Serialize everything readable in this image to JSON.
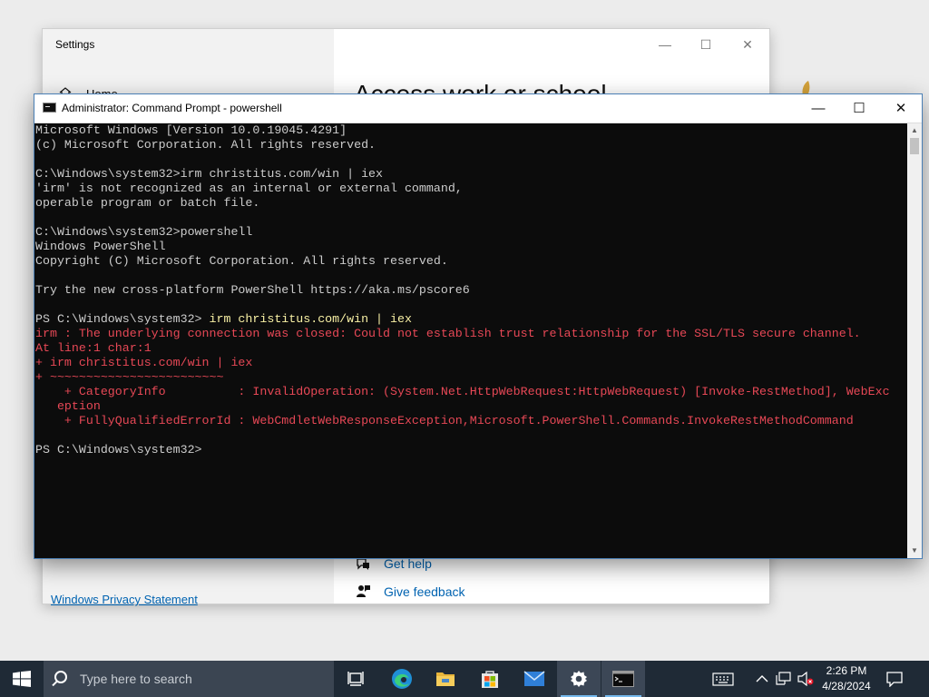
{
  "settings_window": {
    "title": "Settings",
    "home_label": "Home",
    "heading": "Access work or school",
    "get_help": "Get help",
    "give_feedback": "Give feedback",
    "privacy_link": "Windows Privacy Statement"
  },
  "cmd_window": {
    "title": "Administrator: Command Prompt - powershell",
    "lines": [
      {
        "text": "Microsoft Windows [Version 10.0.19045.4291]",
        "style": "normal"
      },
      {
        "text": "(c) Microsoft Corporation. All rights reserved.",
        "style": "normal"
      },
      {
        "text": "",
        "style": "normal"
      },
      {
        "text": "C:\\Windows\\system32>irm christitus.com/win | iex",
        "style": "normal"
      },
      {
        "text": "'irm' is not recognized as an internal or external command,",
        "style": "normal"
      },
      {
        "text": "operable program or batch file.",
        "style": "normal"
      },
      {
        "text": "",
        "style": "normal"
      },
      {
        "text": "C:\\Windows\\system32>powershell",
        "style": "normal"
      },
      {
        "text": "Windows PowerShell",
        "style": "normal"
      },
      {
        "text": "Copyright (C) Microsoft Corporation. All rights reserved.",
        "style": "normal"
      },
      {
        "text": "",
        "style": "normal"
      },
      {
        "text": "Try the new cross-platform PowerShell https://aka.ms/pscore6",
        "style": "normal"
      },
      {
        "text": "",
        "style": "normal"
      },
      {
        "prompt": "PS C:\\Windows\\system32> ",
        "cmd": "irm christitus.com/win | ",
        "cmd_end": "iex",
        "style": "prompt"
      },
      {
        "text": "irm : The underlying connection was closed: Could not establish trust relationship for the SSL/TLS secure channel.",
        "style": "error"
      },
      {
        "text": "At line:1 char:1",
        "style": "error"
      },
      {
        "text": "+ irm christitus.com/win | iex",
        "style": "error"
      },
      {
        "text": "+ ~~~~~~~~~~~~~~~~~~~~~~~~",
        "style": "error"
      },
      {
        "text": "    + CategoryInfo          : InvalidOperation: (System.Net.HttpWebRequest:HttpWebRequest) [Invoke-RestMethod], WebExc",
        "style": "error"
      },
      {
        "text": "   eption",
        "style": "error"
      },
      {
        "text": "    + FullyQualifiedErrorId : WebCmdletWebResponseException,Microsoft.PowerShell.Commands.InvokeRestMethodCommand",
        "style": "error"
      },
      {
        "text": "",
        "style": "normal"
      },
      {
        "text": "PS C:\\Windows\\system32>",
        "style": "normal"
      }
    ]
  },
  "taskbar": {
    "search_placeholder": "Type here to search",
    "time": "2:26 PM",
    "date": "4/28/2024",
    "apps": [
      "task-view",
      "edge",
      "file-explorer",
      "microsoft-store",
      "mail",
      "settings",
      "command-prompt"
    ]
  },
  "colors": {
    "terminal_bg": "#0c0c0c",
    "terminal_fg": "#cccccc",
    "error_fg": "#e74856",
    "command_fg": "#f9f1a5",
    "taskbar_bg": "#1f2a36",
    "link": "#0063b1"
  }
}
